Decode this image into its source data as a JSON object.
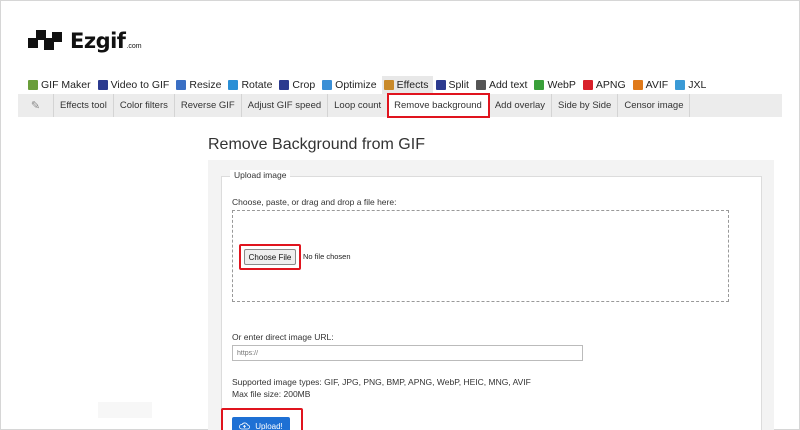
{
  "logo": {
    "text": "Ezgif",
    "suffix": ".com"
  },
  "nav": [
    {
      "label": "GIF Maker",
      "icon": "gif-maker-icon",
      "color": "#6a9e3a"
    },
    {
      "label": "Video to GIF",
      "icon": "video-icon",
      "color": "#2b3a8f"
    },
    {
      "label": "Resize",
      "icon": "resize-icon",
      "color": "#3a6fc4"
    },
    {
      "label": "Rotate",
      "icon": "rotate-icon",
      "color": "#2a8fd6"
    },
    {
      "label": "Crop",
      "icon": "crop-icon",
      "color": "#2b3a8f"
    },
    {
      "label": "Optimize",
      "icon": "optimize-icon",
      "color": "#3a8fd6"
    },
    {
      "label": "Effects",
      "icon": "effects-icon",
      "color": "#c98a2a",
      "active": true
    },
    {
      "label": "Split",
      "icon": "split-icon",
      "color": "#2b3a8f"
    },
    {
      "label": "Add text",
      "icon": "add-text-icon",
      "color": "#555555"
    },
    {
      "label": "WebP",
      "icon": "webp-icon",
      "color": "#3aa03a"
    },
    {
      "label": "APNG",
      "icon": "apng-icon",
      "color": "#d8202a"
    },
    {
      "label": "AVIF",
      "icon": "avif-icon",
      "color": "#e07a1a"
    },
    {
      "label": "JXL",
      "icon": "jxl-icon",
      "color": "#3a9ad6"
    }
  ],
  "subnav": [
    {
      "label": "Effects tool"
    },
    {
      "label": "Color filters"
    },
    {
      "label": "Reverse GIF"
    },
    {
      "label": "Adjust GIF speed"
    },
    {
      "label": "Loop count"
    },
    {
      "label": "Remove background",
      "active": true
    },
    {
      "label": "Add overlay"
    },
    {
      "label": "Side by Side"
    },
    {
      "label": "Censor image"
    }
  ],
  "page_title": "Remove Background from GIF",
  "form": {
    "legend": "Upload image",
    "choose_label": "Choose, paste, or drag and drop a file here:",
    "choose_button": "Choose File",
    "no_file": "No file chosen",
    "url_label": "Or enter direct image URL:",
    "url_placeholder": "https://",
    "supported": "Supported image types: GIF, JPG, PNG, BMP, APNG, WebP, HEIC, MNG, AVIF",
    "max_size": "Max file size: 200MB",
    "upload_button": "Upload!"
  },
  "colors": {
    "highlight": "#e0141e",
    "primary": "#1e70d4"
  }
}
